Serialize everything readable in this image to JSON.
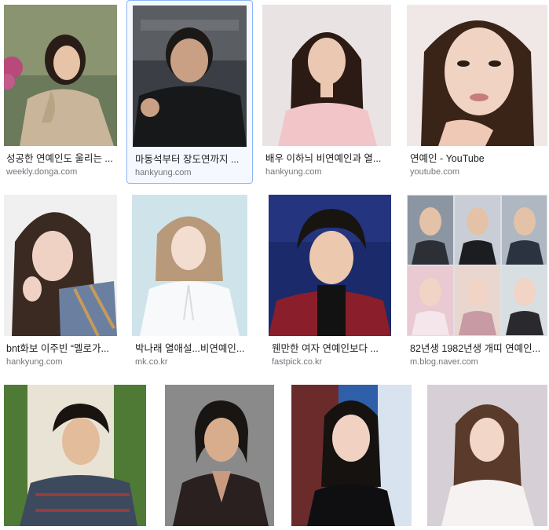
{
  "results": [
    {
      "title": "성공한 연예인도 울리는 ...",
      "source": "weekly.donga.com",
      "icon": "portrait-image"
    },
    {
      "title": "마동석부터 장도연까지 ...",
      "source": "hankyung.com",
      "icon": "portrait-image"
    },
    {
      "title": "배우 이하늬 비연예인과 열...",
      "source": "hankyung.com",
      "icon": "portrait-image"
    },
    {
      "title": "연예인 - YouTube",
      "source": "youtube.com",
      "icon": "portrait-image"
    },
    {
      "title": "bnt화보 이주빈 “멜로가...",
      "source": "hankyung.com",
      "icon": "portrait-image"
    },
    {
      "title": "박나래 열애설...비연예인...",
      "source": "mk.co.kr",
      "icon": "portrait-image"
    },
    {
      "title": "웬만한 여자 연예인보다 ...",
      "source": "fastpick.co.kr",
      "icon": "portrait-image"
    },
    {
      "title": "82년생 1982년생 개띠 연예인...",
      "source": "m.blog.naver.com",
      "icon": "collage-image"
    },
    {
      "title": "",
      "source": "",
      "icon": "portrait-image"
    },
    {
      "title": "",
      "source": "",
      "icon": "portrait-image"
    },
    {
      "title": "",
      "source": "",
      "icon": "portrait-image"
    },
    {
      "title": "",
      "source": "",
      "icon": "portrait-image"
    }
  ],
  "colors": {
    "selected_border": "#8ab4f8",
    "title": "#202124",
    "source": "#70757a"
  }
}
